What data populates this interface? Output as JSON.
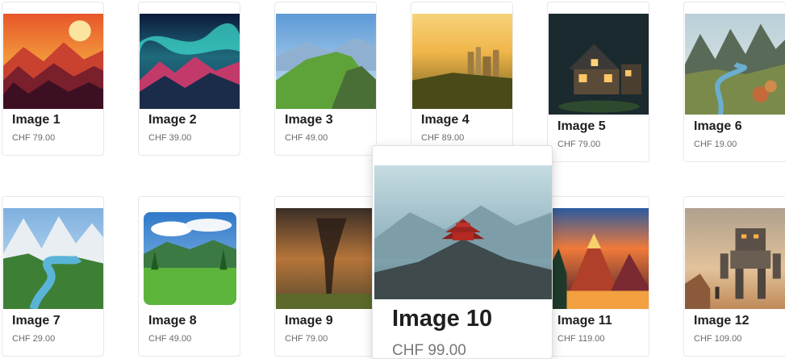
{
  "products": [
    {
      "title": "Image 1",
      "price": "CHF 79.00",
      "icon": "sunset-forest-image"
    },
    {
      "title": "Image 2",
      "price": "CHF 39.00",
      "icon": "aurora-mountains-image"
    },
    {
      "title": "Image 3",
      "price": "CHF 49.00",
      "icon": "green-hills-image"
    },
    {
      "title": "Image 4",
      "price": "CHF 89.00",
      "icon": "city-sunrise-image"
    },
    {
      "title": "Image 5",
      "price": "CHF 79.00",
      "icon": "house-night-image"
    },
    {
      "title": "Image 6",
      "price": "CHF 19.00",
      "icon": "river-valley-image"
    },
    {
      "title": "Image 7",
      "price": "CHF 29.00",
      "icon": "alpine-lake-image"
    },
    {
      "title": "Image 8",
      "price": "CHF 49.00",
      "icon": "meadow-image"
    },
    {
      "title": "Image 9",
      "price": "CHF 79.00",
      "icon": "tornado-image"
    },
    {
      "title": "Image 10",
      "price": "CHF 99.00",
      "icon": "temple-mountain-image"
    },
    {
      "title": "Image 11",
      "price": "CHF 119.00",
      "icon": "volcano-sunset-image"
    },
    {
      "title": "Image 12",
      "price": "CHF 109.00",
      "icon": "robot-desert-image"
    }
  ]
}
